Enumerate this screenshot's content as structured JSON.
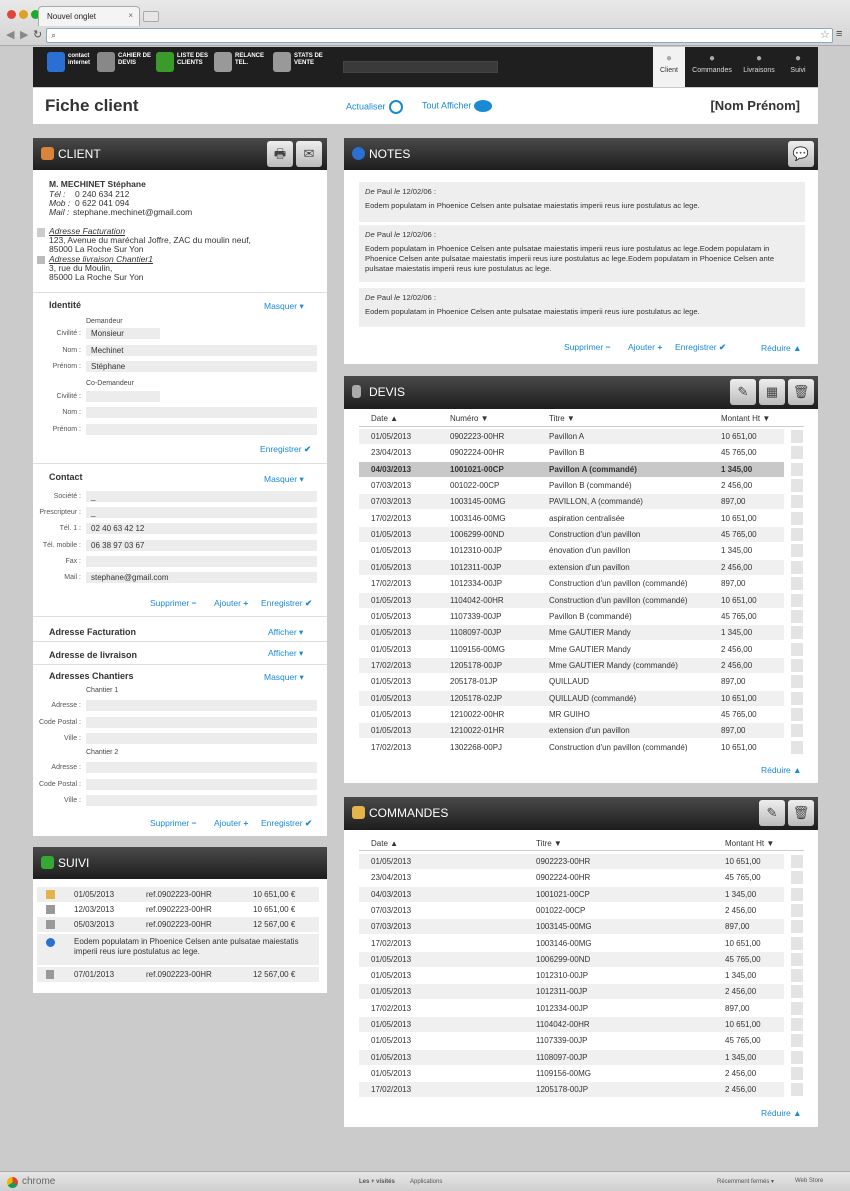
{
  "browser": {
    "tab_title": "Nouvel onglet",
    "tab_close": "×",
    "brand": "chrome",
    "bottom_tabs": [
      "Les + visités",
      "Applications"
    ],
    "bottom_right": [
      "Récemment fermés ▾",
      "Web Store"
    ]
  },
  "topbar": {
    "items": [
      {
        "label": "contact internet",
        "icon": "globe-icon",
        "color": "#2a6fd1"
      },
      {
        "label": "CAHIER DE DEVIS",
        "icon": "calculator-icon",
        "color": "#888888"
      },
      {
        "label": "LISTE DES CLIENTS",
        "icon": "user-icon",
        "color": "#3a9a2a"
      },
      {
        "label": "RELANCE TEL.",
        "icon": "phone-icon",
        "color": "#999999"
      },
      {
        "label": "STATS DE VENTE",
        "icon": "magnifier-icon",
        "color": "#999999"
      }
    ],
    "right": [
      "Client",
      "Commandes",
      "Livraisons",
      "Suivi"
    ]
  },
  "header": {
    "title": "Fiche client",
    "refresh": "Actualiser",
    "show_all": "Tout Afficher",
    "name_placeholder": "[Nom Prénom]"
  },
  "client": {
    "title": "CLIENT",
    "name": "M. MECHINET Stéphane",
    "tel_label": "Tél :",
    "tel": "0 240 634 212",
    "mob_label": "Mob :",
    "mob": "0 622 041 094",
    "mail_label": "Mail :",
    "mail": "stephane.mechinet@gmail.com",
    "billing_label": "Adresse Facturation",
    "billing_lines": [
      "123, Avenue du maréchal Joffre, ZAC du moulin neuf,",
      "85000 La Roche Sur Yon"
    ],
    "delivery_label": "Adresse livraison Chantier1",
    "delivery_lines": [
      "3, rue du Moulin,",
      "85000 La Roche Sur Yon"
    ]
  },
  "identity": {
    "title": "Identité",
    "hide": "Masquer",
    "demandeur": "Demandeur",
    "codemandeur": "Co-Demandeur",
    "civilite": "Civilité :",
    "nom": "Nom :",
    "prenom": "Prénom :",
    "civilite_value": "Monsieur",
    "nom_value": "Mechinet",
    "prenom_value": "Stéphane",
    "save": "Enregistrer"
  },
  "contact": {
    "title": "Contact",
    "hide": "Masquer",
    "labels": [
      "Société :",
      "Prescripteur :",
      "Tél. 1 :",
      "Tél. mobile :",
      "Fax :",
      "Mail :"
    ],
    "values": [
      "_",
      "_",
      "02 40 63 42 12",
      "06 38 97 03 67",
      "",
      "stephane@gmail.com"
    ],
    "delete": "Supprimer",
    "add": "Ajouter",
    "save": "Enregistrer"
  },
  "addresses": {
    "billing": "Adresse Facturation",
    "delivery": "Adresse de livraison",
    "show": "Afficher",
    "sites": "Adresses Chantiers",
    "hide": "Masquer",
    "site1": "Chantier 1",
    "site2": "Chantier 2",
    "labels": [
      "Adresse :",
      "Code Postal :",
      "Ville :"
    ],
    "delete": "Supprimer",
    "add": "Ajouter",
    "save": "Enregistrer"
  },
  "suivi": {
    "title": "SUIVI",
    "rows": [
      {
        "date": "01/05/2013",
        "ref": "ref.0902223-00HR",
        "amount": "10 651,00 €",
        "icon": "box-icon"
      },
      {
        "date": "12/03/2013",
        "ref": "ref.0902223-00HR",
        "amount": "10 651,00 €",
        "icon": "calculator-icon"
      },
      {
        "date": "05/03/2013",
        "ref": "ref.0902223-00HR",
        "amount": "12 567,00 €",
        "icon": "calculator-icon"
      }
    ],
    "note": "Eodem populatam in Phoenice Celsen ante pulsatae maiestatis imperii reus iure postulatus ac lege.",
    "last": {
      "date": "07/01/2013",
      "ref": "ref.0902223-00HR",
      "amount": "12 567,00 €"
    }
  },
  "notes": {
    "title": "NOTES",
    "items": [
      {
        "from": "De",
        "author": "Paul",
        "le": "le",
        "date": "12/02/06 :",
        "text": "Eodem populatam in Phoenice Celsen ante pulsatae maiestatis imperii reus iure postulatus ac lege."
      },
      {
        "from": "De",
        "author": "Paul",
        "le": "le",
        "date": "12/02/06 :",
        "text": "Eodem populatam in Phoenice Celsen ante pulsatae maiestatis imperii reus iure postulatus ac lege.Eodem populatam in Phoenice Celsen ante pulsatae maiestatis imperii reus iure postulatus ac lege.Eodem populatam in Phoenice Celsen ante pulsatae maiestatis imperii reus iure postulatus ac lege."
      },
      {
        "from": "De",
        "author": "Paul",
        "le": "le",
        "date": "12/02/06 :",
        "text": "Eodem populatam in Phoenice Celsen ante pulsatae maiestatis imperii reus iure postulatus ac lege."
      }
    ],
    "delete": "Supprimer",
    "add": "Ajouter",
    "save": "Enregistrer",
    "collapse": "Réduire"
  },
  "devis": {
    "title": "DEVIS",
    "columns": [
      "Date",
      "Numéro",
      "Titre",
      "Montant Ht"
    ],
    "rows": [
      [
        "01/05/2013",
        "0902223-00HR",
        "Pavillon A",
        "10 651,00"
      ],
      [
        "23/04/2013",
        "0902224-00HR",
        "Pavillon B",
        "45 765,00"
      ],
      [
        "04/03/2013",
        "1001021-00CP",
        "Pavillon A (commandé)",
        "1 345,00"
      ],
      [
        "07/03/2013",
        "001022-00CP",
        "Pavillon B (commandé)",
        "2 456,00"
      ],
      [
        "07/03/2013",
        "1003145-00MG",
        "PAVILLON, A (commandé)",
        "897,00"
      ],
      [
        "17/02/2013",
        "1003146-00MG",
        "aspiration centralisée",
        "10 651,00"
      ],
      [
        "01/05/2013",
        "1006299-00ND",
        "Construction d'un pavillon",
        "45 765,00"
      ],
      [
        "01/05/2013",
        "1012310-00JP",
        "énovation d'un pavillon",
        "1 345,00"
      ],
      [
        "01/05/2013",
        "1012311-00JP",
        "extension d'un pavillon",
        "2 456,00"
      ],
      [
        "17/02/2013",
        "1012334-00JP",
        "Construction d'un pavillon (commandé)",
        "897,00"
      ],
      [
        "01/05/2013",
        "1104042-00HR",
        "Construction d'un pavillon (commandé)",
        "10 651,00"
      ],
      [
        "01/05/2013",
        "1107339-00JP",
        "Pavillon B (commandé)",
        "45 765,00"
      ],
      [
        "01/05/2013",
        "1108097-00JP",
        "Mme GAUTIER Mandy",
        "1 345,00"
      ],
      [
        "01/05/2013",
        "1109156-00MG",
        "Mme GAUTIER Mandy",
        "2 456,00"
      ],
      [
        "17/02/2013",
        "1205178-00JP",
        "Mme GAUTIER Mandy (commandé)",
        "2 456,00"
      ],
      [
        "01/05/2013",
        "205178-01JP",
        "QUILLAUD",
        "897,00"
      ],
      [
        "01/05/2013",
        "1205178-02JP",
        "QUILLAUD (commandé)",
        "10 651,00"
      ],
      [
        "01/05/2013",
        "1210022-00HR",
        "MR GUIHO",
        "45 765,00"
      ],
      [
        "01/05/2013",
        "1210022-01HR",
        "extension d'un pavillon",
        "897,00"
      ],
      [
        "17/02/2013",
        "1302268-00PJ",
        "Construction d'un pavillon (commandé)",
        "10 651,00"
      ]
    ],
    "selected_row": 2,
    "collapse": "Réduire"
  },
  "commandes": {
    "title": "COMMANDES",
    "columns": [
      "Date",
      "Titre",
      "Montant Ht"
    ],
    "rows": [
      [
        "01/05/2013",
        "0902223-00HR",
        "10 651,00"
      ],
      [
        "23/04/2013",
        "0902224-00HR",
        "45 765,00"
      ],
      [
        "04/03/2013",
        "1001021-00CP",
        "1 345,00"
      ],
      [
        "07/03/2013",
        "001022-00CP",
        "2 456,00"
      ],
      [
        "07/03/2013",
        "1003145-00MG",
        "897,00"
      ],
      [
        "17/02/2013",
        "1003146-00MG",
        "10 651,00"
      ],
      [
        "01/05/2013",
        "1006299-00ND",
        "45 765,00"
      ],
      [
        "01/05/2013",
        "1012310-00JP",
        "1 345,00"
      ],
      [
        "01/05/2013",
        "1012311-00JP",
        "2 456,00"
      ],
      [
        "17/02/2013",
        "1012334-00JP",
        "897,00"
      ],
      [
        "01/05/2013",
        "1104042-00HR",
        "10 651,00"
      ],
      [
        "01/05/2013",
        "1107339-00JP",
        "45 765,00"
      ],
      [
        "01/05/2013",
        "1108097-00JP",
        "1 345,00"
      ],
      [
        "01/05/2013",
        "1109156-00MG",
        "2 456,00"
      ],
      [
        "17/02/2013",
        "1205178-00JP",
        "2 456,00"
      ]
    ],
    "collapse": "Réduire"
  }
}
